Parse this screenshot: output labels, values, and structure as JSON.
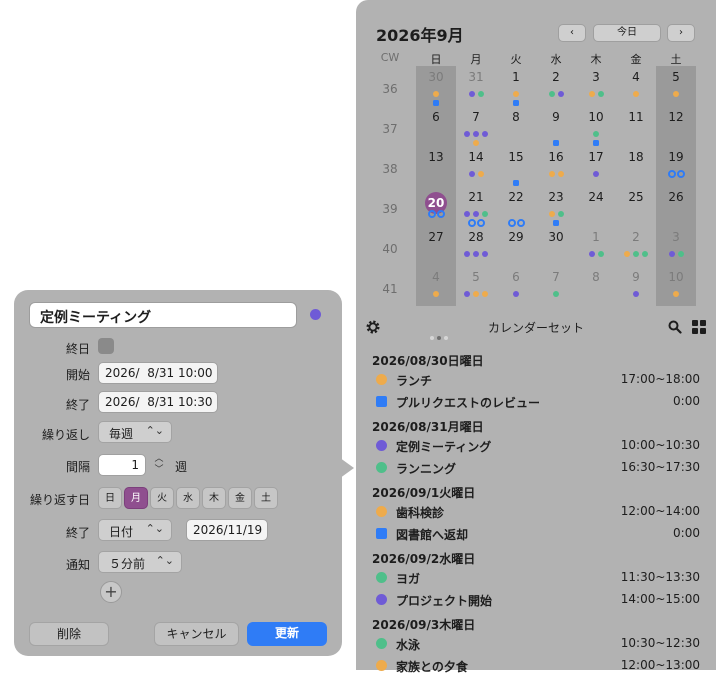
{
  "editor": {
    "title": "定例ミーティング",
    "color": "#6f5bd6",
    "all_day_label": "終日",
    "start_label": "開始",
    "start_value": "2026/  8/31 10:00",
    "end_label": "終了",
    "end_value": "2026/  8/31 10:30",
    "repeat_label": "繰り返し",
    "repeat_value": "毎週",
    "interval_label": "間隔",
    "interval_value": "1",
    "interval_unit": "週",
    "repeat_days_label": "繰り返す日",
    "days": [
      "日",
      "月",
      "火",
      "水",
      "木",
      "金",
      "土"
    ],
    "selected_day_index": 1,
    "repeat_end_label": "終了",
    "repeat_end_type": "日付",
    "repeat_end_date": "2026/11/19",
    "notify_label": "通知",
    "notify_value": "５分前",
    "add_icon": "plus-icon",
    "delete_label": "削除",
    "cancel_label": "キャンセル",
    "update_label": "更新"
  },
  "calendar": {
    "month_title": "2026年9月",
    "prev_icon": "chevron-left-icon",
    "today_label": "今日",
    "next_icon": "chevron-right-icon",
    "cw_label": "CW",
    "weekdays": [
      "日",
      "月",
      "火",
      "水",
      "木",
      "金",
      "土"
    ],
    "weeks": [
      {
        "cw": "36",
        "days": [
          "30",
          "31",
          "1",
          "2",
          "3",
          "4",
          "5"
        ]
      },
      {
        "cw": "37",
        "days": [
          "6",
          "7",
          "8",
          "9",
          "10",
          "11",
          "12"
        ]
      },
      {
        "cw": "38",
        "days": [
          "13",
          "14",
          "15",
          "16",
          "17",
          "18",
          "19"
        ]
      },
      {
        "cw": "39",
        "days": [
          "20",
          "21",
          "22",
          "23",
          "24",
          "25",
          "26"
        ]
      },
      {
        "cw": "40",
        "days": [
          "27",
          "28",
          "29",
          "30",
          "1",
          "2",
          "3"
        ]
      },
      {
        "cw": "41",
        "days": [
          "4",
          "5",
          "6",
          "7",
          "8",
          "9",
          "10"
        ]
      }
    ],
    "today": "20",
    "colors": {
      "orange": "#eeab4c",
      "blue": "#2f7cf6",
      "purple": "#6f5bd6",
      "green": "#4fbf8a",
      "today": "#8f4f8f"
    }
  },
  "toolbar": {
    "settings_icon": "gear-icon",
    "calendar_set_label": "カレンダーセット",
    "search_icon": "search-icon",
    "grid_icon": "grid-icon"
  },
  "agenda": [
    {
      "date": "2026/08/30日曜日",
      "events": [
        {
          "title": "ランチ",
          "time": "17:00~18:00",
          "color": "#eeab4c",
          "shape": "circle"
        },
        {
          "title": "プルリクエストのレビュー",
          "time": "0:00",
          "color": "#2f7cf6",
          "shape": "square"
        }
      ]
    },
    {
      "date": "2026/08/31月曜日",
      "events": [
        {
          "title": "定例ミーティング",
          "time": "10:00~10:30",
          "color": "#6f5bd6",
          "shape": "circle"
        },
        {
          "title": "ランニング",
          "time": "16:30~17:30",
          "color": "#4fbf8a",
          "shape": "circle"
        }
      ]
    },
    {
      "date": "2026/09/1火曜日",
      "events": [
        {
          "title": "歯科検診",
          "time": "12:00~14:00",
          "color": "#eeab4c",
          "shape": "circle"
        },
        {
          "title": "図書館へ返却",
          "time": "0:00",
          "color": "#2f7cf6",
          "shape": "square"
        }
      ]
    },
    {
      "date": "2026/09/2水曜日",
      "events": [
        {
          "title": "ヨガ",
          "time": "11:30~13:30",
          "color": "#4fbf8a",
          "shape": "circle"
        },
        {
          "title": "プロジェクト開始",
          "time": "14:00~15:00",
          "color": "#6f5bd6",
          "shape": "circle"
        }
      ]
    },
    {
      "date": "2026/09/3木曜日",
      "events": [
        {
          "title": "水泳",
          "time": "10:30~12:30",
          "color": "#4fbf8a",
          "shape": "circle"
        },
        {
          "title": "家族との夕食",
          "time": "12:00~13:00",
          "color": "#eeab4c",
          "shape": "circle"
        }
      ]
    }
  ]
}
